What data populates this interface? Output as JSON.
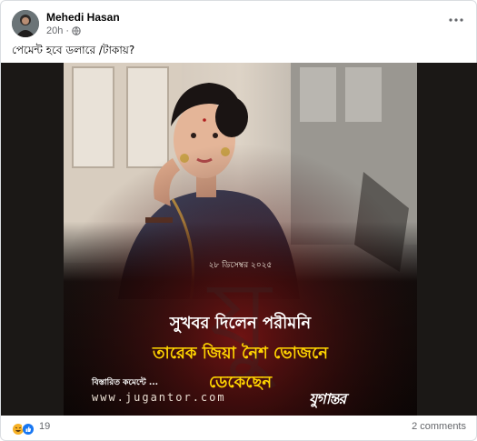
{
  "post": {
    "author": "Mehedi Hasan",
    "time": "20h",
    "time_separator": "·",
    "privacy_icon": "globe-icon",
    "more_icon": "more-horizontal-icon",
    "caption": "পেমেন্ট হবে ডলারে /টাকায়?"
  },
  "image": {
    "date": "২৮ ডিসেম্বর ২০২৫",
    "headline_line1": "সুখবর দিলেন পরীমনি",
    "headline_line2": "তারেক জিয়া নৈশ ভোজনে",
    "headline_line3": "ডেকেছেন",
    "details": "বিস্তারিত কমেন্টে ...",
    "website": "www.jugantor.com",
    "logo": "যুগান্তর"
  },
  "footer": {
    "reaction_icons": [
      "haha-icon",
      "like-icon"
    ],
    "reaction_count": "19",
    "comments": "2 comments"
  },
  "colors": {
    "headline_white": "#ffffff",
    "headline_yellow": "#ffd400",
    "dark_red": "#5a0a0a",
    "meta_gray": "#65676b",
    "like_blue": "#1877f2"
  }
}
